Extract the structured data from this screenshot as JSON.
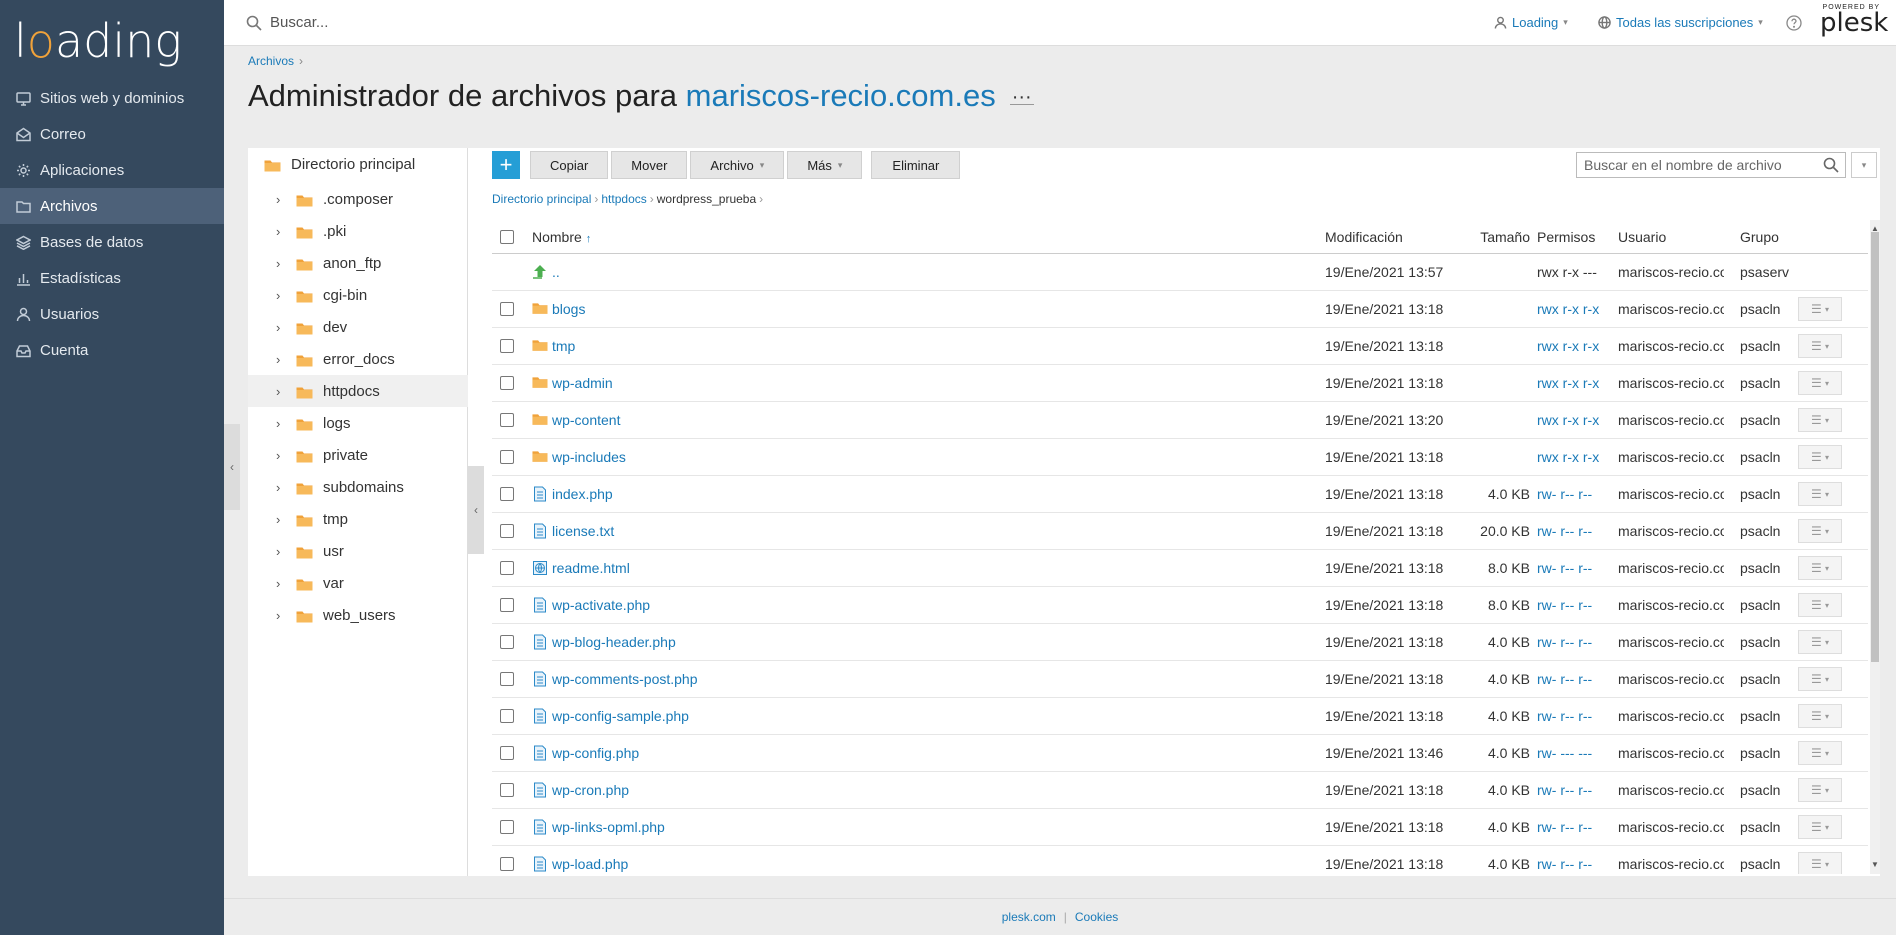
{
  "brand": {
    "logo_text_pre": "l",
    "logo_text_o": "o",
    "logo_text_post": "ading"
  },
  "sidebar": {
    "items": [
      {
        "label": "Sitios web y dominios",
        "icon": "monitor-icon",
        "active": false
      },
      {
        "label": "Correo",
        "icon": "mail-icon",
        "active": false
      },
      {
        "label": "Aplicaciones",
        "icon": "gear-icon",
        "active": false
      },
      {
        "label": "Archivos",
        "icon": "folder-icon",
        "active": true
      },
      {
        "label": "Bases de datos",
        "icon": "layers-icon",
        "active": false
      },
      {
        "label": "Estadísticas",
        "icon": "bar-chart-icon",
        "active": false
      },
      {
        "label": "Usuarios",
        "icon": "user-icon",
        "active": false
      },
      {
        "label": "Cuenta",
        "icon": "inbox-icon",
        "active": false
      }
    ]
  },
  "topbar": {
    "search_placeholder": "Buscar...",
    "user_label": "Loading",
    "subscriptions_label": "Todas las suscripciones",
    "powered_by": "POWERED BY",
    "plesk_logo": "plesk"
  },
  "title": {
    "breadcrumb": "Archivos",
    "prefix": "Administrador de archivos para ",
    "domain": "mariscos-recio.com.es",
    "more": "···"
  },
  "tree": {
    "root": "Directorio principal",
    "items": [
      ".composer",
      ".pki",
      "anon_ftp",
      "cgi-bin",
      "dev",
      "error_docs",
      "httpdocs",
      "logs",
      "private",
      "subdomains",
      "tmp",
      "usr",
      "var",
      "web_users"
    ],
    "selected": "httpdocs"
  },
  "toolbar": {
    "add": "+",
    "copy": "Copiar",
    "move": "Mover",
    "archive": "Archivo",
    "more": "Más",
    "delete": "Eliminar",
    "search_placeholder": "Buscar en el nombre de archivo"
  },
  "path": {
    "root": "Directorio principal",
    "mid": "httpdocs",
    "current": "wordpress_prueba"
  },
  "table": {
    "headers": {
      "name": "Nombre",
      "modified": "Modificación",
      "size": "Tamaño",
      "perms": "Permisos",
      "user": "Usuario",
      "group": "Grupo"
    },
    "rows": [
      {
        "name": "..",
        "type": "up",
        "modified": "19/Ene/2021 13:57",
        "size": "",
        "perms": "rwx r-x ---",
        "user": "mariscos-recio.com.es",
        "group": "psaserv"
      },
      {
        "name": "blogs",
        "type": "folder",
        "modified": "19/Ene/2021 13:18",
        "size": "",
        "perms": "rwx r-x r-x",
        "user": "mariscos-recio.com.es",
        "group": "psacln"
      },
      {
        "name": "tmp",
        "type": "folder",
        "modified": "19/Ene/2021 13:18",
        "size": "",
        "perms": "rwx r-x r-x",
        "user": "mariscos-recio.com.es",
        "group": "psacln"
      },
      {
        "name": "wp-admin",
        "type": "folder",
        "modified": "19/Ene/2021 13:18",
        "size": "",
        "perms": "rwx r-x r-x",
        "user": "mariscos-recio.com.es",
        "group": "psacln"
      },
      {
        "name": "wp-content",
        "type": "folder",
        "modified": "19/Ene/2021 13:20",
        "size": "",
        "perms": "rwx r-x r-x",
        "user": "mariscos-recio.com.es",
        "group": "psacln"
      },
      {
        "name": "wp-includes",
        "type": "folder",
        "modified": "19/Ene/2021 13:18",
        "size": "",
        "perms": "rwx r-x r-x",
        "user": "mariscos-recio.com.es",
        "group": "psacln"
      },
      {
        "name": "index.php",
        "type": "file",
        "modified": "19/Ene/2021 13:18",
        "size": "4.0 KB",
        "perms": "rw- r-- r--",
        "user": "mariscos-recio.com.es",
        "group": "psacln"
      },
      {
        "name": "license.txt",
        "type": "file",
        "modified": "19/Ene/2021 13:18",
        "size": "20.0 KB",
        "perms": "rw- r-- r--",
        "user": "mariscos-recio.com.es",
        "group": "psacln"
      },
      {
        "name": "readme.html",
        "type": "html",
        "modified": "19/Ene/2021 13:18",
        "size": "8.0 KB",
        "perms": "rw- r-- r--",
        "user": "mariscos-recio.com.es",
        "group": "psacln"
      },
      {
        "name": "wp-activate.php",
        "type": "file",
        "modified": "19/Ene/2021 13:18",
        "size": "8.0 KB",
        "perms": "rw- r-- r--",
        "user": "mariscos-recio.com.es",
        "group": "psacln"
      },
      {
        "name": "wp-blog-header.php",
        "type": "file",
        "modified": "19/Ene/2021 13:18",
        "size": "4.0 KB",
        "perms": "rw- r-- r--",
        "user": "mariscos-recio.com.es",
        "group": "psacln"
      },
      {
        "name": "wp-comments-post.php",
        "type": "file",
        "modified": "19/Ene/2021 13:18",
        "size": "4.0 KB",
        "perms": "rw- r-- r--",
        "user": "mariscos-recio.com.es",
        "group": "psacln"
      },
      {
        "name": "wp-config-sample.php",
        "type": "file",
        "modified": "19/Ene/2021 13:18",
        "size": "4.0 KB",
        "perms": "rw- r-- r--",
        "user": "mariscos-recio.com.es",
        "group": "psacln"
      },
      {
        "name": "wp-config.php",
        "type": "file",
        "modified": "19/Ene/2021 13:46",
        "size": "4.0 KB",
        "perms": "rw- --- ---",
        "user": "mariscos-recio.com.es",
        "group": "psacln"
      },
      {
        "name": "wp-cron.php",
        "type": "file",
        "modified": "19/Ene/2021 13:18",
        "size": "4.0 KB",
        "perms": "rw- r-- r--",
        "user": "mariscos-recio.com.es",
        "group": "psacln"
      },
      {
        "name": "wp-links-opml.php",
        "type": "file",
        "modified": "19/Ene/2021 13:18",
        "size": "4.0 KB",
        "perms": "rw- r-- r--",
        "user": "mariscos-recio.com.es",
        "group": "psacln"
      },
      {
        "name": "wp-load.php",
        "type": "file",
        "modified": "19/Ene/2021 13:18",
        "size": "4.0 KB",
        "perms": "rw- r-- r--",
        "user": "mariscos-recio.com.es",
        "group": "psacln"
      }
    ]
  },
  "footer": {
    "link1": "plesk.com",
    "link2": "Cookies"
  },
  "colors": {
    "sidebar": "#35495e",
    "accent": "#1a7ab8",
    "add_button": "#259ed6",
    "folder": "#f0a23a"
  }
}
